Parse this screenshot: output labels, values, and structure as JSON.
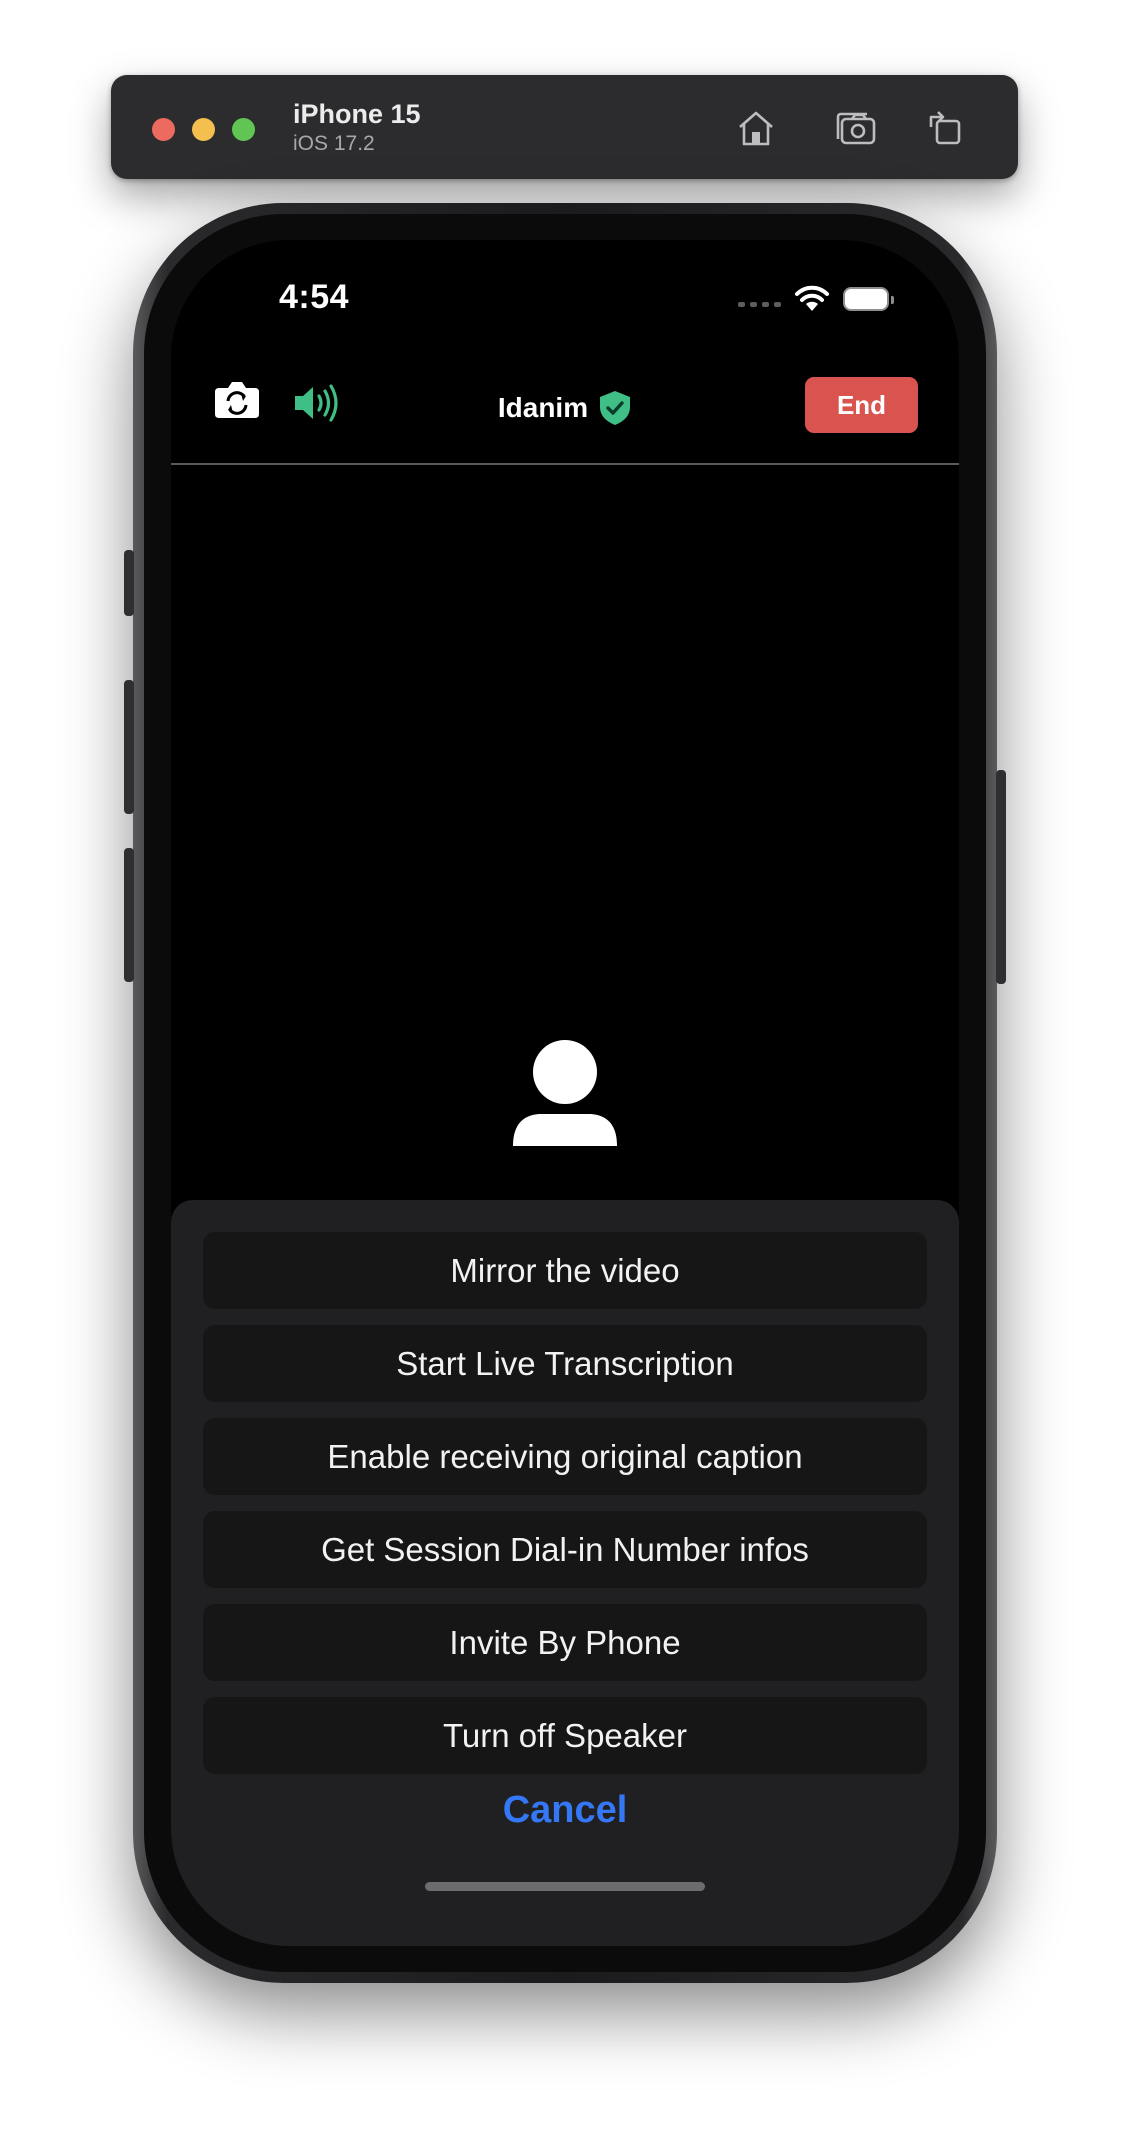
{
  "simulator": {
    "device_name": "iPhone 15",
    "os_version": "iOS 17.2",
    "tools": [
      "home-icon",
      "screenshot-icon",
      "rotate-icon"
    ]
  },
  "status_bar": {
    "time": "4:54"
  },
  "meeting": {
    "title": "Idanim",
    "end_label": "End",
    "speaker_color": "#3fbf86",
    "shield_color": "#3fbf86",
    "end_color": "#d9534f"
  },
  "action_sheet": {
    "items": [
      "Mirror the video",
      "Start Live Transcription",
      "Enable receiving original caption",
      "Get Session Dial-in Number infos",
      "Invite By Phone",
      "Turn off Speaker"
    ],
    "cancel_label": "Cancel",
    "cancel_color": "#3478f6"
  }
}
